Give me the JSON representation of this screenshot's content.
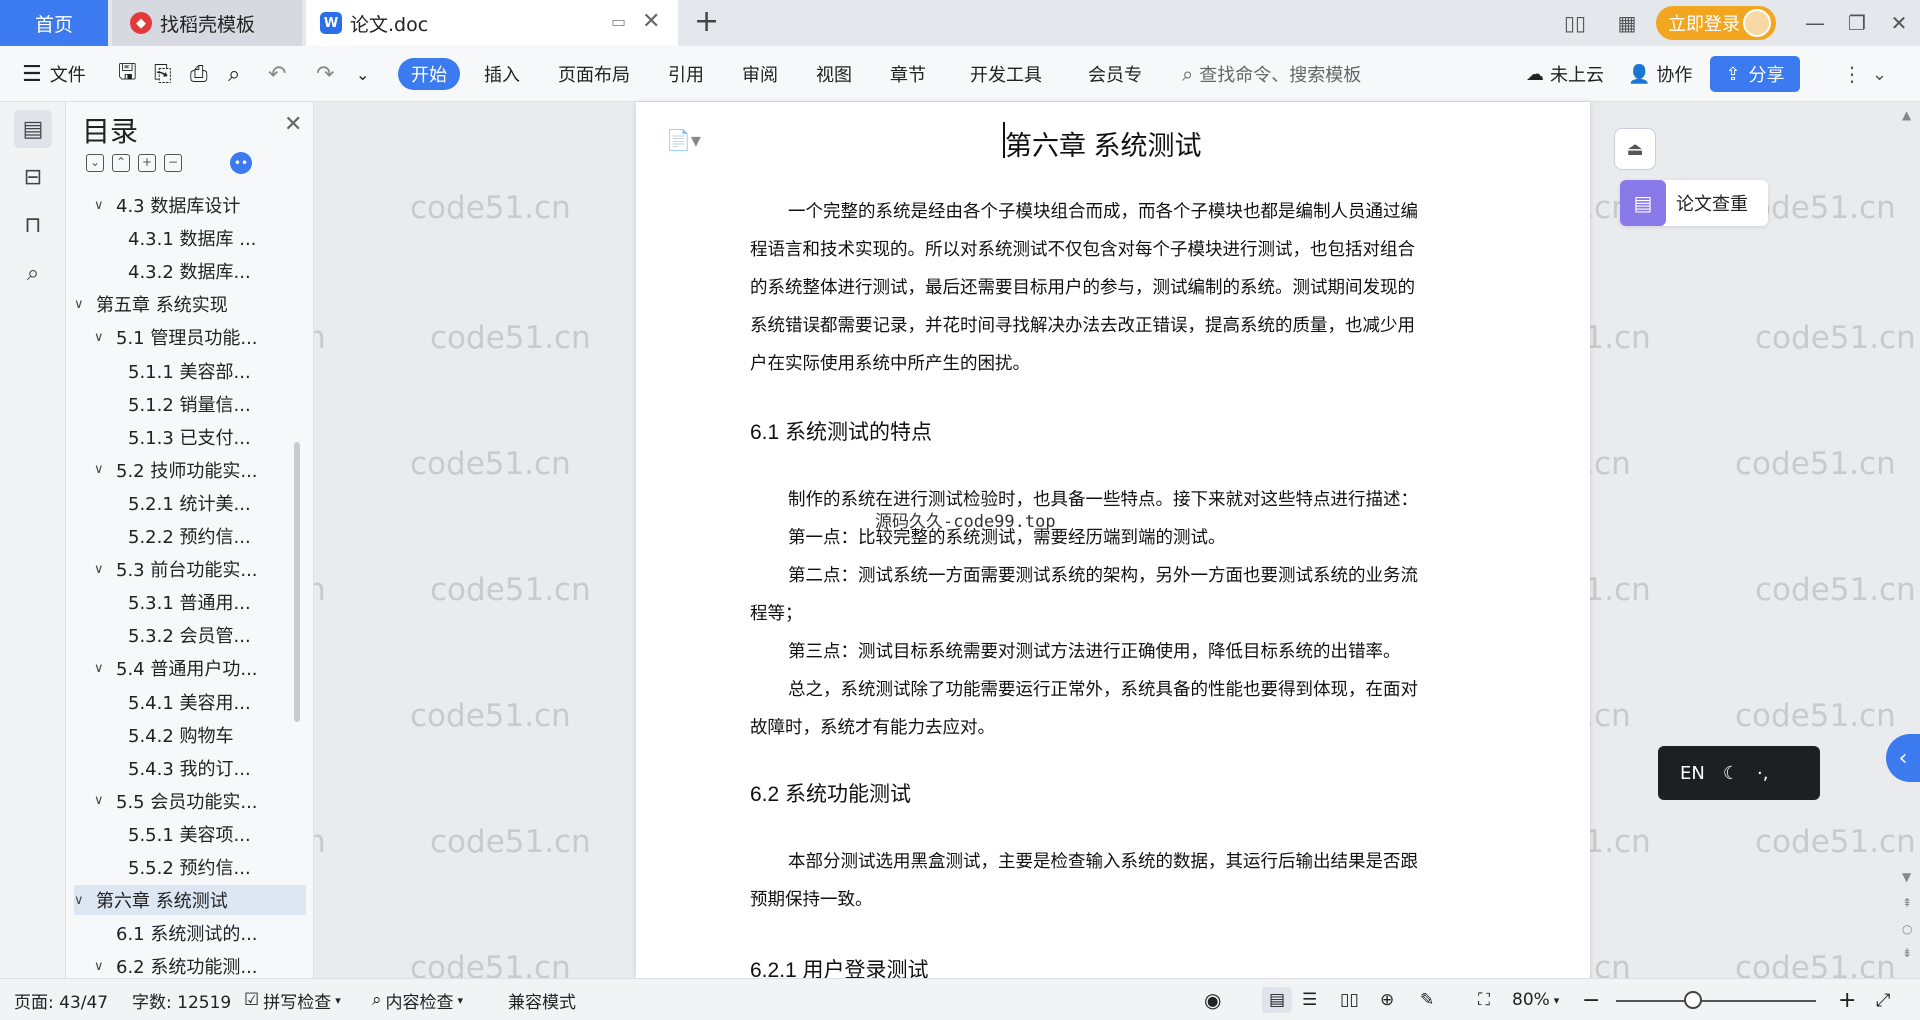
{
  "tabs": {
    "home": "首页",
    "template": "找稻壳模板",
    "doc": "论文.doc",
    "new_tab": "+"
  },
  "titlebar": {
    "login": "立即登录"
  },
  "ribbon": {
    "file": "文件",
    "tabs": [
      "开始",
      "插入",
      "页面布局",
      "引用",
      "审阅",
      "视图",
      "章节",
      "开发工具",
      "会员专"
    ],
    "search_placeholder": "查找命令、搜索模板",
    "cloud": "未上云",
    "collab": "协作",
    "share": "分享"
  },
  "toc": {
    "title": "目录",
    "items": [
      {
        "text": "4.3 数据库设计",
        "level": 2,
        "chevron": true
      },
      {
        "text": "4.3.1  数据库 ...",
        "level": 3
      },
      {
        "text": "4.3.2  数据库...",
        "level": 3
      },
      {
        "text": "第五章  系统实现",
        "level": 1,
        "chevron": true
      },
      {
        "text": "5.1 管理员功能...",
        "level": 2,
        "chevron": true
      },
      {
        "text": "5.1.1  美容部...",
        "level": 3
      },
      {
        "text": "5.1.2  销量信...",
        "level": 3
      },
      {
        "text": "5.1.3  已支付...",
        "level": 3
      },
      {
        "text": "5.2 技师功能实...",
        "level": 2,
        "chevron": true
      },
      {
        "text": "5.2.1  统计美...",
        "level": 3
      },
      {
        "text": "5.2.2  预约信...",
        "level": 3
      },
      {
        "text": "5.3  前台功能实...",
        "level": 2,
        "chevron": true
      },
      {
        "text": "5.3.1  普通用...",
        "level": 3
      },
      {
        "text": "5.3.2  会员管...",
        "level": 3
      },
      {
        "text": "5.4  普通用户功...",
        "level": 2,
        "chevron": true
      },
      {
        "text": "5.4.1  美容用...",
        "level": 3
      },
      {
        "text": "5.4.2  购物车",
        "level": 3
      },
      {
        "text": "5.4.3  我的订...",
        "level": 3
      },
      {
        "text": "5.5  会员功能实...",
        "level": 2,
        "chevron": true
      },
      {
        "text": "5.5.1  美容项...",
        "level": 3
      },
      {
        "text": "5.5.2  预约信...",
        "level": 3
      },
      {
        "text": "第六章  系统测试",
        "level": 1,
        "chevron": true,
        "selected": true
      },
      {
        "text": "6.1 系统测试的...",
        "level": 2
      },
      {
        "text": "6.2  系统功能测...",
        "level": 2,
        "chevron": true
      }
    ]
  },
  "document": {
    "chapter_title": "第六章  系统测试",
    "para1": [
      "一个完整的系统是经由各个子模块组合而成，而各个子模块也都是编制人员通过编",
      "程语言和技术实现的。所以对系统测试不仅包含对每个子模块进行测试，也包括对组合",
      "的系统整体进行测试，最后还需要目标用户的参与，测试编制的系统。测试期间发现的",
      "系统错误都需要记录，并花时间寻找解决办法去改正错误，提高系统的质量，也减少用",
      "户在实际使用系统中所产生的困扰。"
    ],
    "h61": "6.1 系统测试的特点",
    "s61": [
      "制作的系统在进行测试检验时，也具备一些特点。接下来就对这些特点进行描述：",
      "第一点：比较完整的系统测试，需要经历端到端的测试。",
      "第二点：测试系统一方面需要测试系统的架构，另外一方面也要测试系统的业务流",
      "程等；",
      "第三点：测试目标系统需要对测试方法进行正确使用，降低目标系统的出错率。",
      "总之，系统测试除了功能需要运行正常外，系统具备的性能也要得到体现，在面对",
      "故障时，系统才有能力去应对。"
    ],
    "h62": "6.2  系统功能测试",
    "s62": [
      "本部分测试选用黑盒测试，主要是检查输入系统的数据，其运行后输出结果是否跟",
      "预期保持一致。"
    ],
    "h621": "6.2.1  用户登录测试",
    "watermark_text": "源码久久-code99.top"
  },
  "right_panel": {
    "plagiarism": "论文查重",
    "ime": "EN"
  },
  "status": {
    "page": "页面: 43/47",
    "words": "字数: 12519",
    "spell": "拼写检查",
    "content": "内容检查",
    "compat": "兼容模式",
    "zoom": "80%"
  },
  "watermark": "code51.cn",
  "colors": {
    "accent": "#3c7af0",
    "login": "#f2a51e",
    "plag": "#8a79e8"
  }
}
